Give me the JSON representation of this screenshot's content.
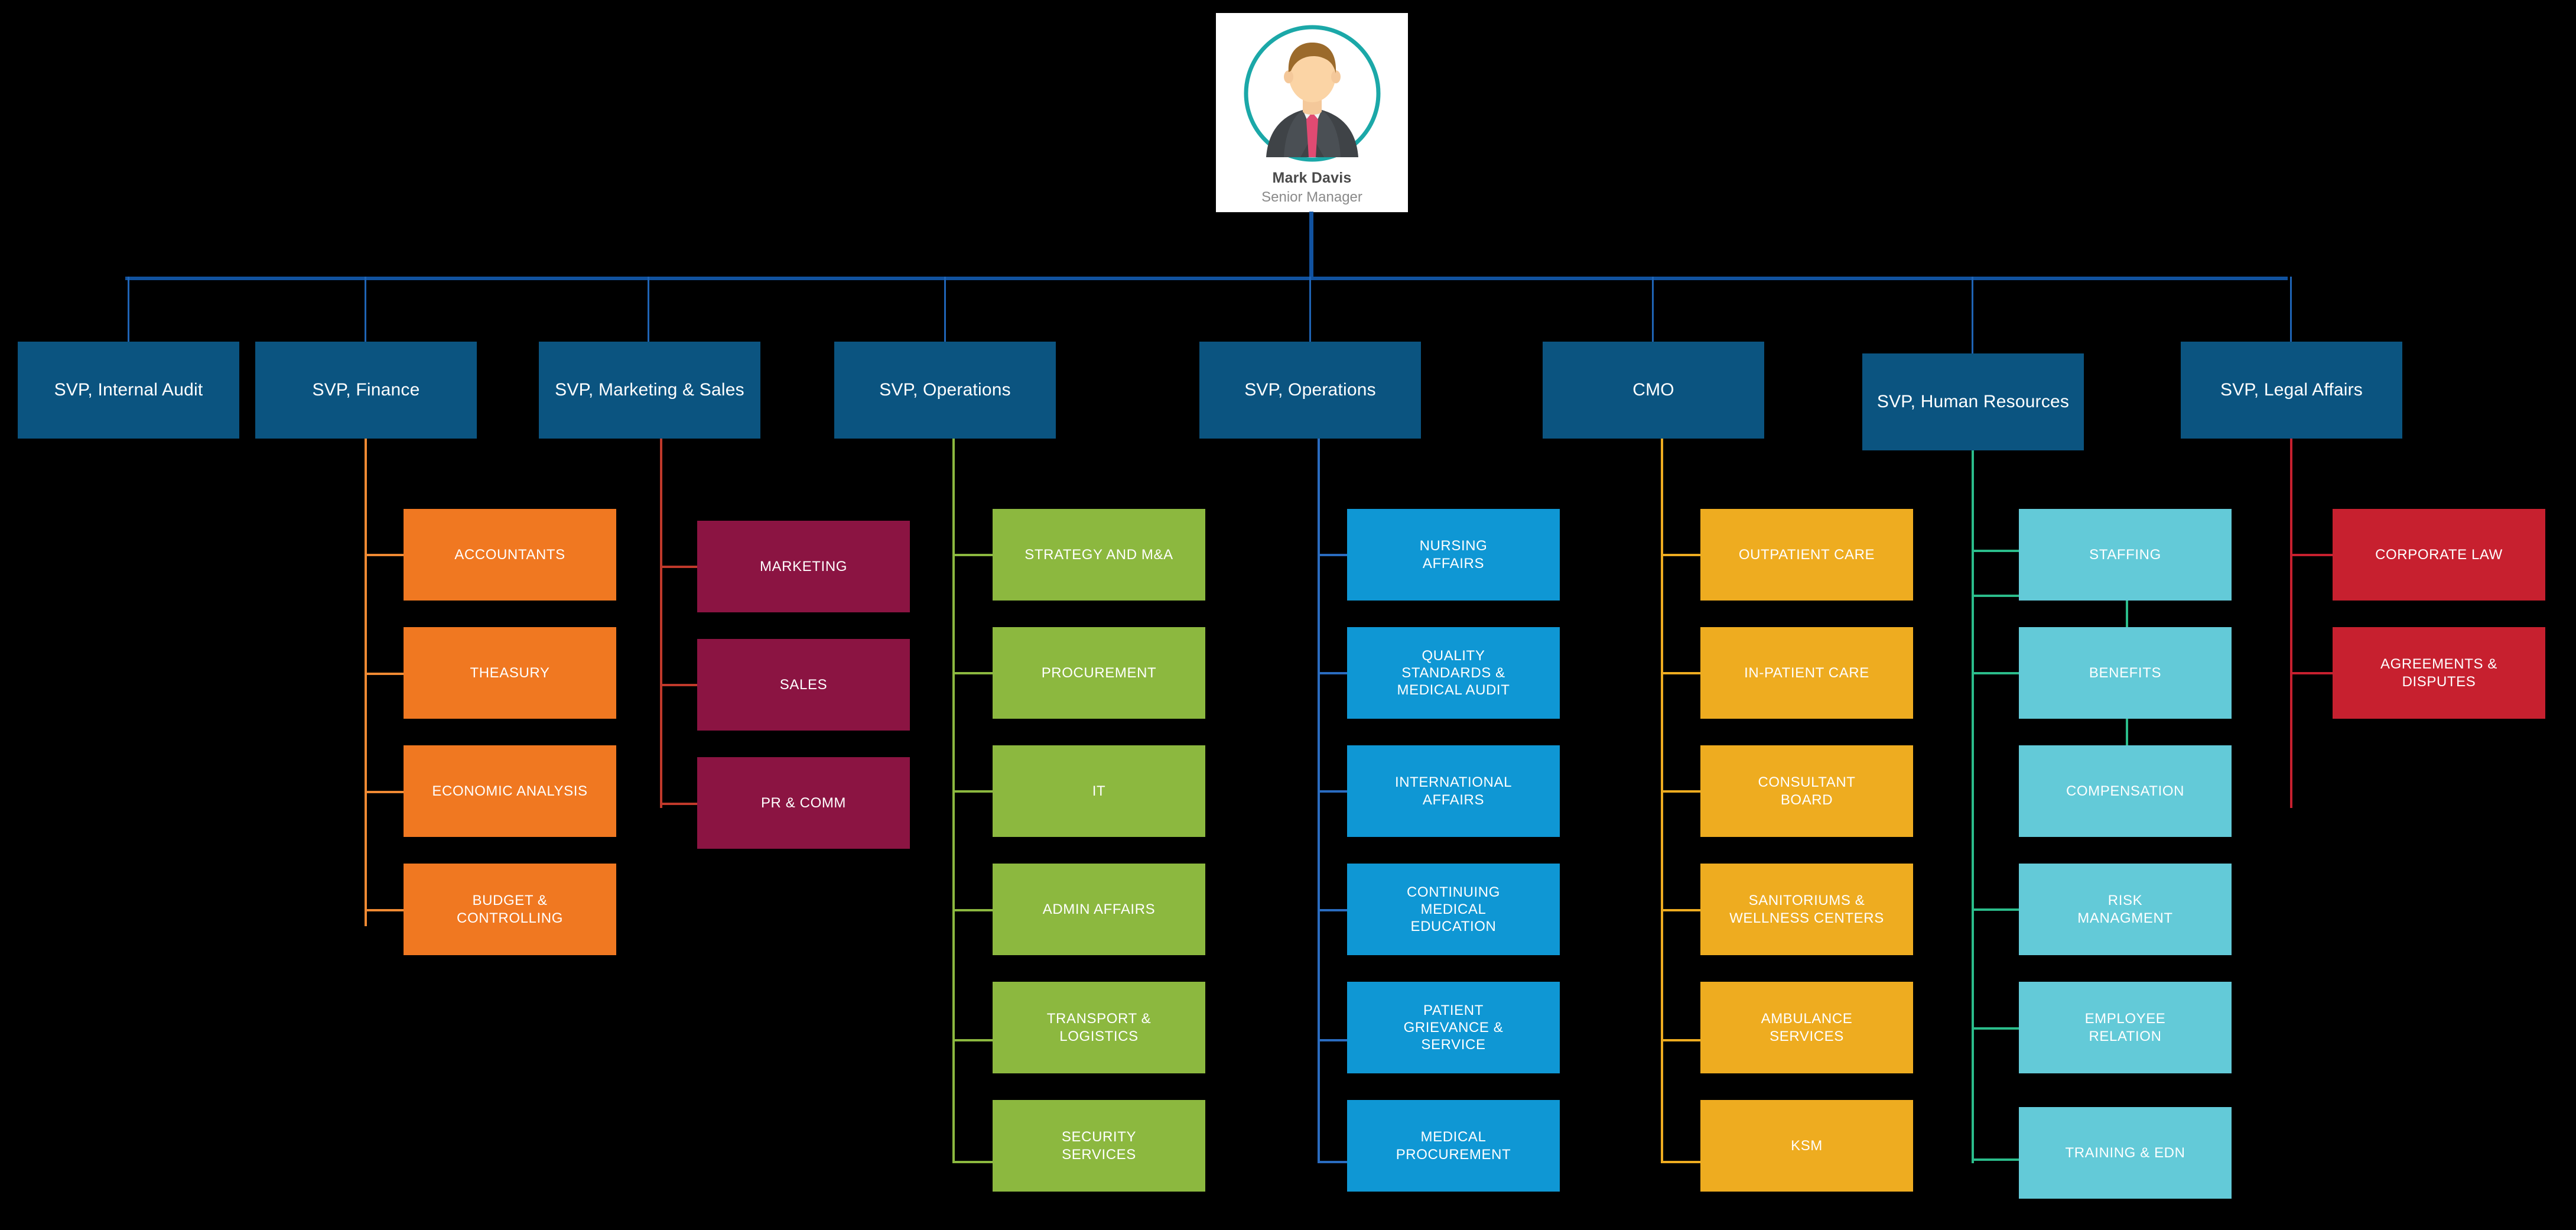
{
  "root": {
    "name": "Mark Davis",
    "role": "Senior Manager",
    "avatar_icon": "person-avatar-icon",
    "card_bg": "#ffffff",
    "ring_color": "#1ba8a8"
  },
  "palette": {
    "level1_box": "#0b5480",
    "level1_connector": "#11529f",
    "bus_color": "#11529f",
    "finance_box": "#f07821",
    "finance_connector": "#f08a33",
    "marketing_box": "#8b1442",
    "marketing_connector": "#c0392b",
    "operations_box": "#8cb83f",
    "operations_connector": "#8cb83f",
    "medical_box": "#0f97d4",
    "medical_connector": "#2a6cc0",
    "cmo_box": "#eeac20",
    "cmo_connector": "#eeac20",
    "hr_box": "#63cad8",
    "hr_connector": "#2bbd8b",
    "legal_box": "#c7202f",
    "legal_connector": "#c7202f",
    "background": "#000000"
  },
  "level1": [
    {
      "id": "internal-audit",
      "label": "SVP, Internal Audit"
    },
    {
      "id": "finance",
      "label": "SVP, Finance"
    },
    {
      "id": "marketing-sales",
      "label": "SVP, Marketing & Sales"
    },
    {
      "id": "operations-1",
      "label": "SVP, Operations"
    },
    {
      "id": "operations-2",
      "label": "SVP, Operations"
    },
    {
      "id": "cmo",
      "label": "CMO"
    },
    {
      "id": "human-resources",
      "label": "SVP, Human Resources"
    },
    {
      "id": "legal-affairs",
      "label": "SVP, Legal Affairs"
    }
  ],
  "columns": {
    "finance": {
      "parent": "SVP, Finance",
      "items": [
        "ACCOUNTANTS",
        "THEASURY",
        "ECONOMIC ANALYSIS",
        "BUDGET &\nCONTROLLING"
      ]
    },
    "marketing": {
      "parent": "SVP, Marketing & Sales",
      "items": [
        "MARKETING",
        "SALES",
        "PR & COMM"
      ]
    },
    "operations": {
      "parent": "SVP, Operations",
      "items": [
        "STRATEGY AND M&A",
        "PROCUREMENT",
        "IT",
        "ADMIN AFFAIRS",
        "TRANSPORT &\nLOGISTICS",
        "SECURITY\nSERVICES"
      ]
    },
    "medical": {
      "parent": "SVP, Operations",
      "items": [
        "NURSING\nAFFAIRS",
        "QUALITY\nSTANDARDS &\nMEDICAL AUDIT",
        "INTERNATIONAL\nAFFAIRS",
        "CONTINUING\nMEDICAL\nEDUCATION",
        "PATIENT\nGRIEVANCE &\nSERVICE",
        "MEDICAL\nPROCUREMENT"
      ]
    },
    "cmo": {
      "parent": "CMO",
      "items": [
        "OUTPATIENT  CARE",
        "IN-PATIENT  CARE",
        "CONSULTANT\nBOARD",
        "SANITORIUMS &\nWELLNESS CENTERS",
        "AMBULANCE\nSERVICES",
        "KSM"
      ]
    },
    "hr": {
      "parent": "SVP, Human Resources",
      "items": [
        "STAFFING",
        "BENEFITS",
        "COMPENSATION",
        "RISK\nMANAGMENT",
        "EMPLOYEE\nRELATION",
        "TRAINING & EDN"
      ]
    },
    "legal": {
      "parent": "SVP, Legal Affairs",
      "items": [
        "CORPORATE LAW",
        "AGREEMENTS &\nDISPUTES"
      ]
    }
  }
}
